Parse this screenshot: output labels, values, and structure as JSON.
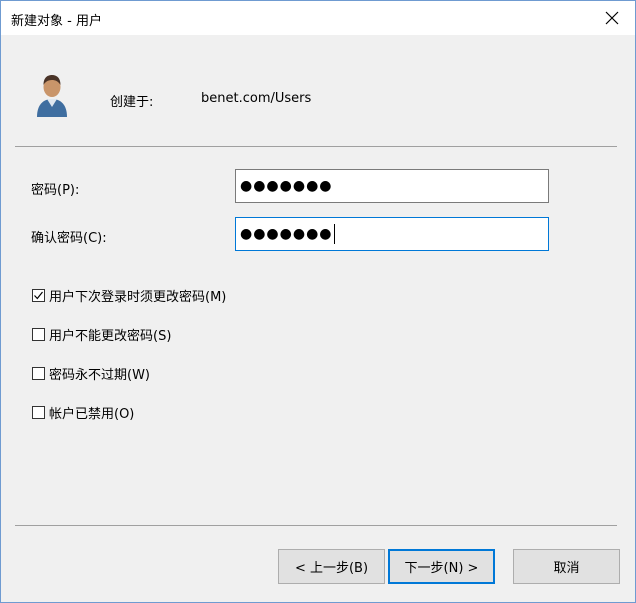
{
  "window": {
    "title": "新建对象 - 用户"
  },
  "header": {
    "created_in_label": "创建于:",
    "created_in_value": "benet.com/Users"
  },
  "form": {
    "password_label": "密码(P):",
    "password_value": "●●●●●●●",
    "confirm_label": "确认密码(C):",
    "confirm_value": "●●●●●●●"
  },
  "options": [
    {
      "label": "用户下次登录时须更改密码(M)",
      "checked": true
    },
    {
      "label": "用户不能更改密码(S)",
      "checked": false
    },
    {
      "label": "密码永不过期(W)",
      "checked": false
    },
    {
      "label": "帐户已禁用(O)",
      "checked": false
    }
  ],
  "buttons": {
    "back": "< 上一步(B)",
    "next": "下一步(N) >",
    "cancel": "取消"
  },
  "icons": {
    "close": "close-icon",
    "user": "user-icon",
    "check": "checkmark-icon"
  },
  "colors": {
    "accent": "#0078d7",
    "window_border": "#6f9bd1",
    "button_bg": "#e1e1e1"
  }
}
